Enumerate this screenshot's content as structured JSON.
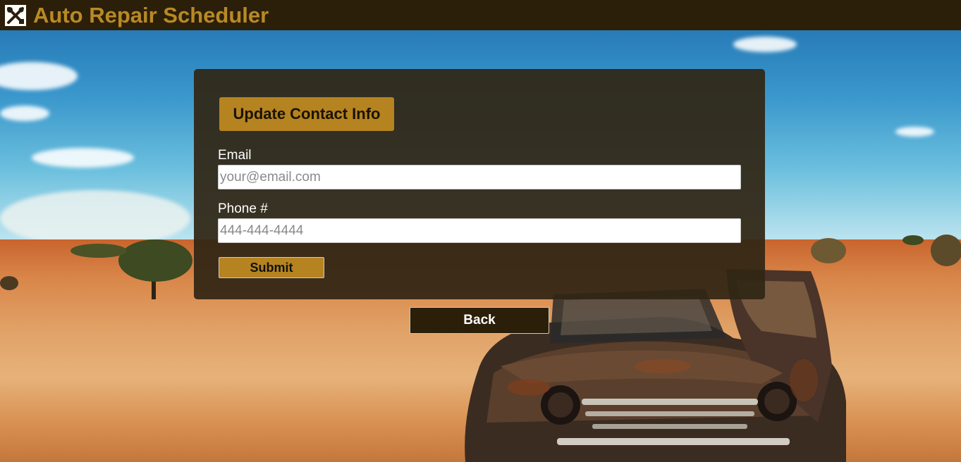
{
  "header": {
    "title": "Auto Repair Scheduler",
    "logo_icon": "wrench-screwdriver-icon"
  },
  "form": {
    "heading": "Update Contact Info",
    "email": {
      "label": "Email",
      "placeholder": "your@email.com",
      "value": ""
    },
    "phone": {
      "label": "Phone #",
      "placeholder": "444-444-4444",
      "value": ""
    },
    "submit_label": "Submit"
  },
  "back_label": "Back",
  "colors": {
    "header_bg": "#2c1f09",
    "accent": "#b5831f",
    "title_text": "#b88a25"
  }
}
